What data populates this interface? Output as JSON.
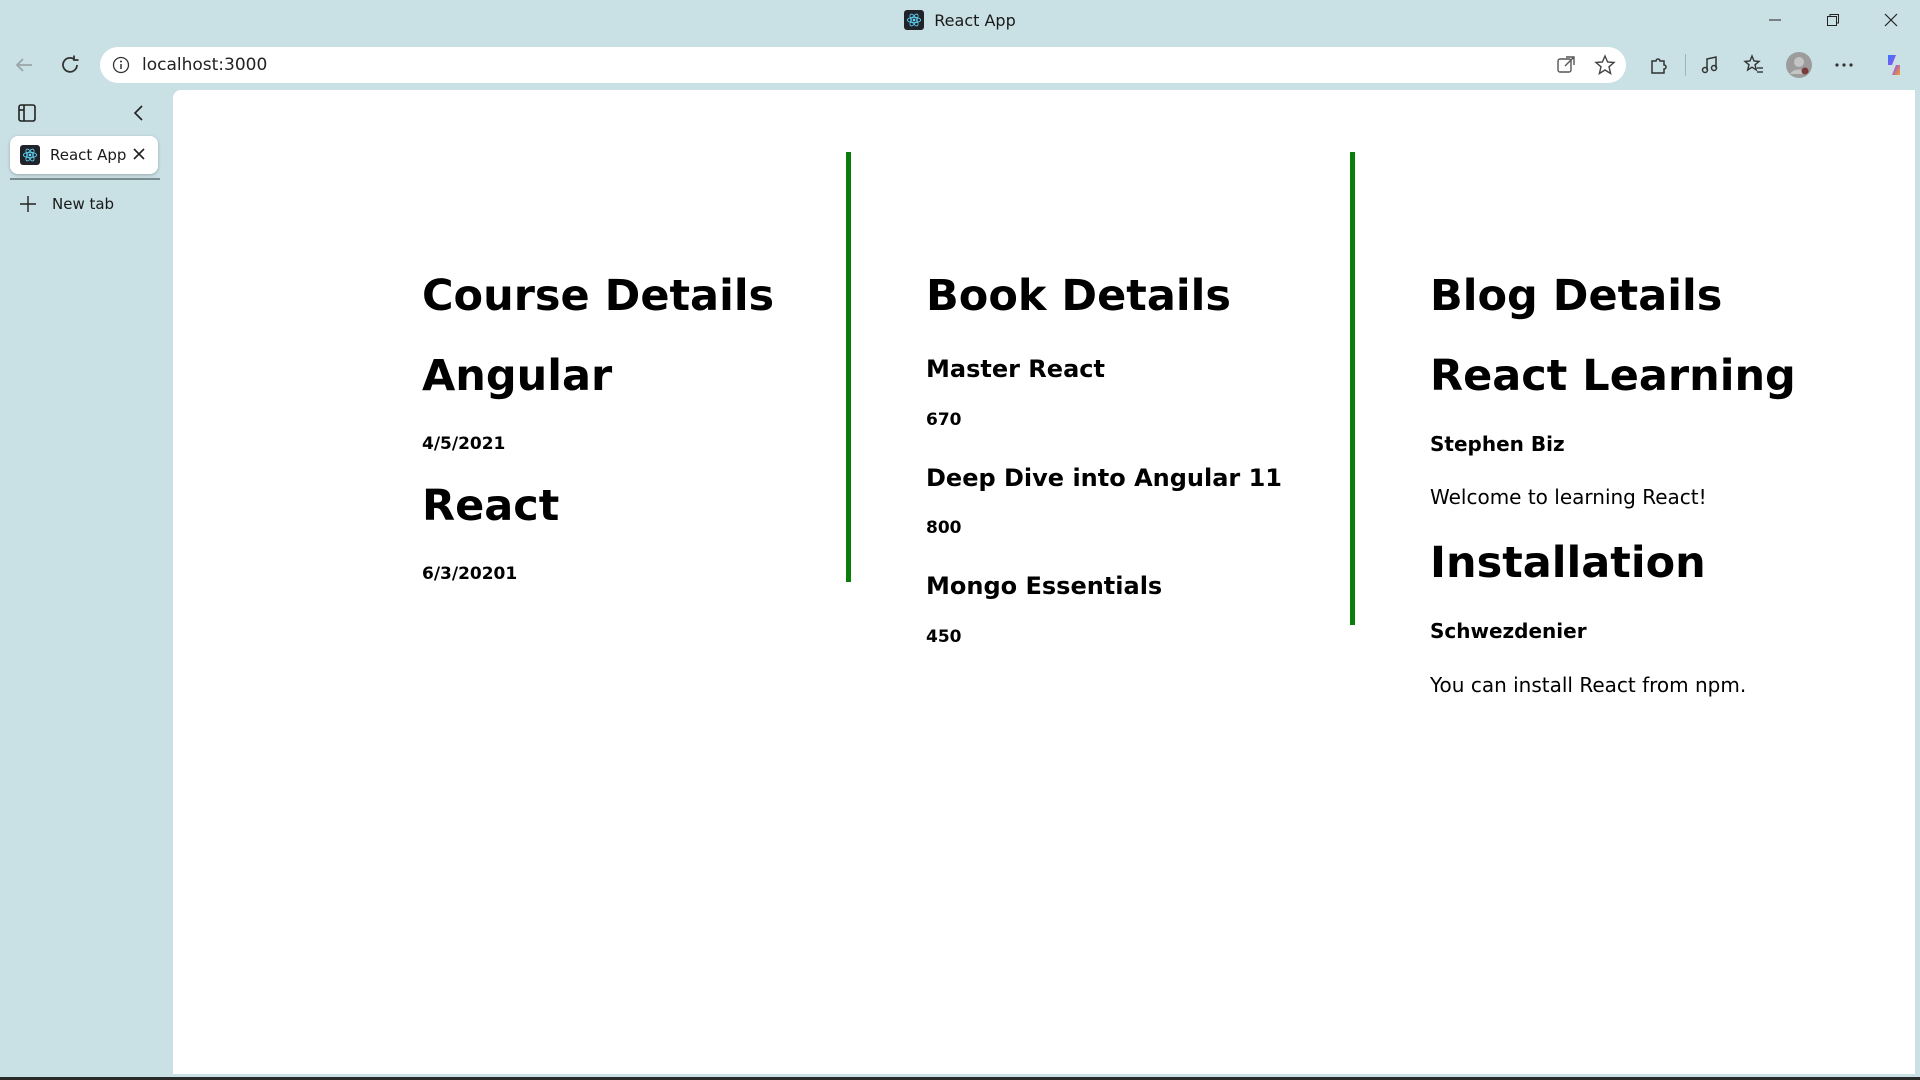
{
  "window": {
    "title": "React App"
  },
  "toolbar": {
    "url": "localhost:3000"
  },
  "sidebar": {
    "tabs": [
      {
        "label": "React App"
      }
    ],
    "new_tab_label": "New tab"
  },
  "colors": {
    "divider": "#0b7d0b",
    "chrome_bg": "#c9e0e4"
  },
  "courses": {
    "heading": "Course Details",
    "items": [
      {
        "name": "Angular",
        "date": "4/5/2021"
      },
      {
        "name": "React",
        "date": "6/3/20201"
      }
    ]
  },
  "books": {
    "heading": "Book Details",
    "items": [
      {
        "name": "Master React",
        "price": "670"
      },
      {
        "name": "Deep Dive into Angular 11",
        "price": "800"
      },
      {
        "name": "Mongo Essentials",
        "price": "450"
      }
    ]
  },
  "blogs": {
    "heading": "Blog Details",
    "items": [
      {
        "title": "React Learning",
        "author": "Stephen Biz",
        "content": "Welcome to learning React!"
      },
      {
        "title": "Installation",
        "author": "Schwezdenier",
        "content": "You can install React from npm."
      }
    ]
  }
}
